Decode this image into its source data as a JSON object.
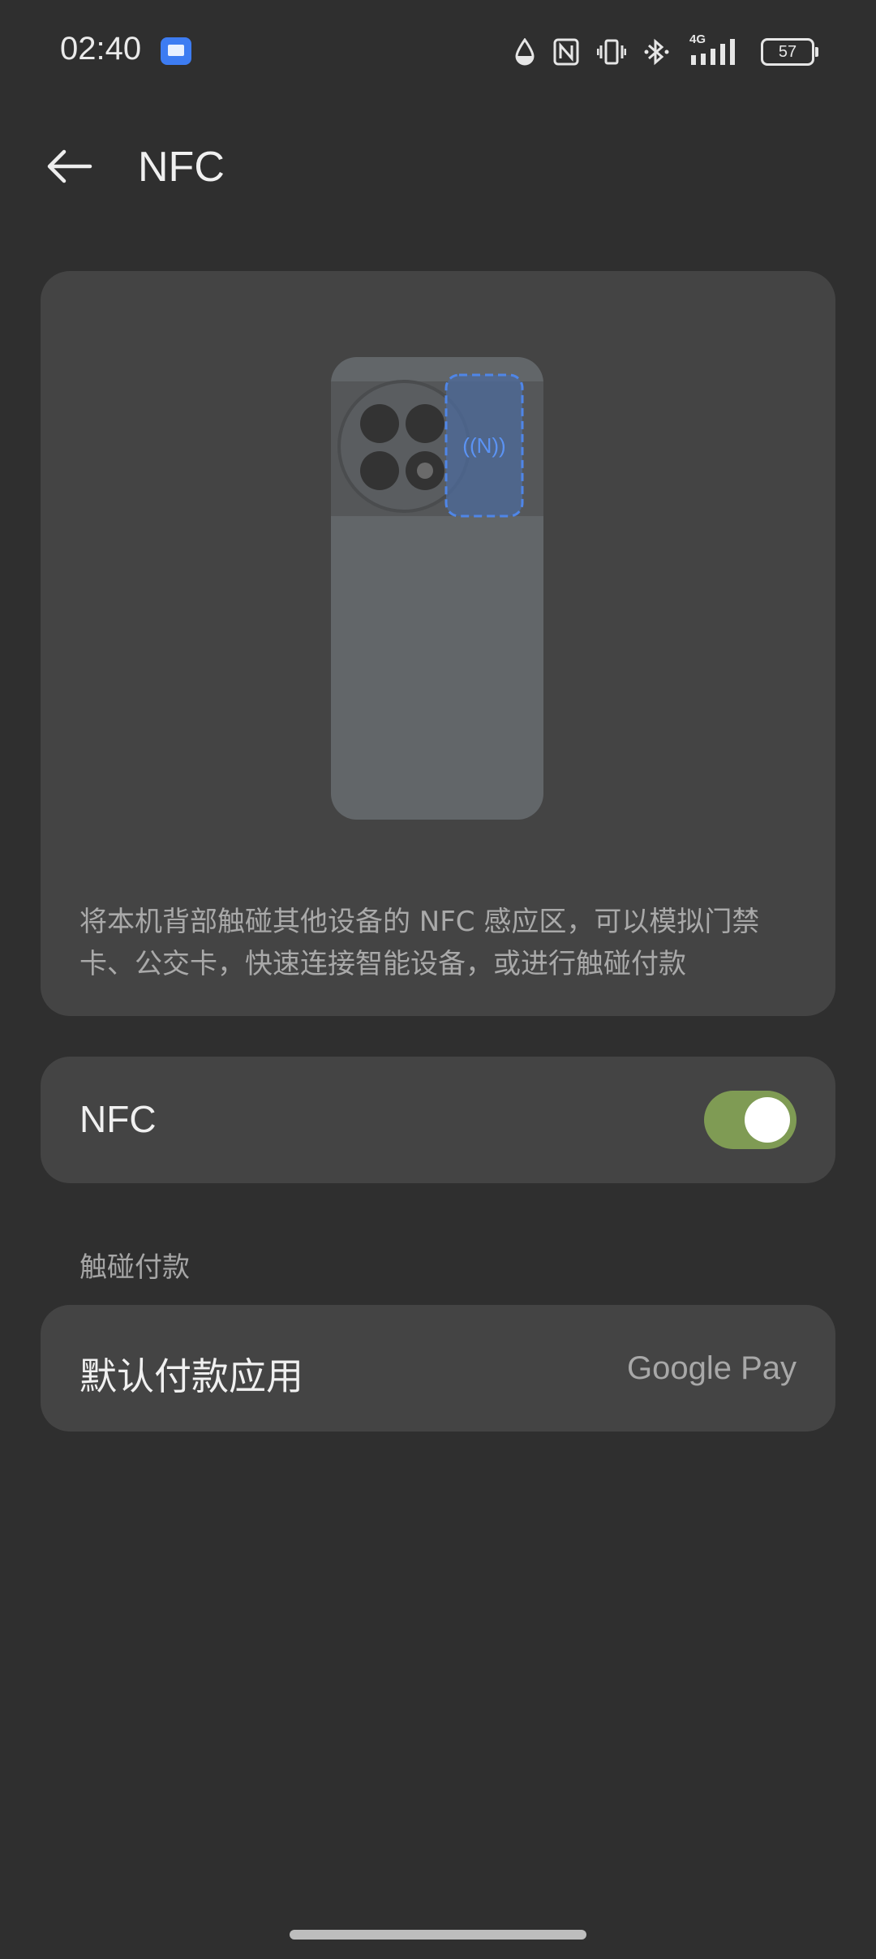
{
  "status_bar": {
    "time": "02:40",
    "network": "4G",
    "battery": "57",
    "icons": [
      "notification-app-icon",
      "data-saver-icon",
      "nfc-icon",
      "vibrate-icon",
      "bluetooth-icon",
      "signal-4g-icon",
      "battery-icon"
    ]
  },
  "header": {
    "title": "NFC",
    "back_icon": "back-arrow-icon"
  },
  "illustration": {
    "description": "将本机背部触碰其他设备的 NFC 感应区，可以模拟门禁卡、公交卡，快速连接智能设备，或进行触碰付款",
    "nfc_symbol": "((N))",
    "accent_color": "#3d7cf2"
  },
  "nfc_setting": {
    "label": "NFC",
    "enabled": true,
    "switch_color": "#7f9b54"
  },
  "payment_section": {
    "header": "触碰付款",
    "default_app_label": "默认付款应用",
    "default_app_value": "Google Pay"
  }
}
